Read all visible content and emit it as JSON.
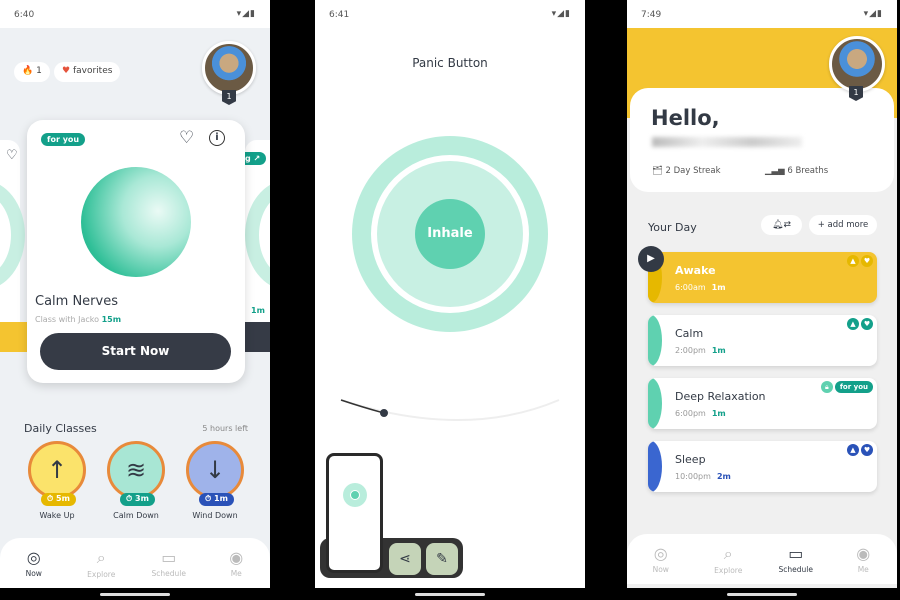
{
  "screen1": {
    "time": "6:40",
    "streak": "1",
    "favorites": "favorites",
    "level": "1",
    "card": {
      "tag": "for you",
      "title": "Calm Nerves",
      "subtitle": "Class with Jacko",
      "duration": "15m",
      "button": "Start Now"
    },
    "side_duration": "1m",
    "daily": {
      "title": "Daily Classes",
      "remaining": "5 hours left",
      "classes": [
        {
          "label": "Wake Up",
          "duration": "5m",
          "icon": "arrow-up-icon",
          "color": "#fbe36b",
          "badge": "#e6b800"
        },
        {
          "label": "Calm Down",
          "duration": "3m",
          "icon": "waves-icon",
          "color": "#a8e6d4",
          "badge": "#13a08a"
        },
        {
          "label": "Wind Down",
          "duration": "1m",
          "icon": "arrow-down-icon",
          "color": "#9fb3ea",
          "badge": "#2a52b8"
        }
      ]
    },
    "nav": [
      "Now",
      "Explore",
      "Schedule",
      "Me"
    ]
  },
  "screen2": {
    "time": "6:41",
    "title": "Panic Button",
    "center": "Inhale",
    "accent": "#5fd1b0"
  },
  "screen3": {
    "time": "7:49",
    "greeting": "Hello,",
    "streak": "2 Day Streak",
    "breaths": "6 Breaths",
    "level": "1",
    "your_day": "Your Day",
    "add_more": "+ add more",
    "items": [
      {
        "title": "Awake",
        "time": "6:00am",
        "duration": "1m",
        "color": "#f4c430"
      },
      {
        "title": "Calm",
        "time": "2:00pm",
        "duration": "1m",
        "color": "#5fd1b0"
      },
      {
        "title": "Deep Relaxation",
        "time": "6:00pm",
        "duration": "1m",
        "color": "#5fd1b0",
        "tag": "for you"
      },
      {
        "title": "Sleep",
        "time": "10:00pm",
        "duration": "2m",
        "color": "#3a66d0"
      }
    ],
    "nav": [
      "Now",
      "Explore",
      "Schedule",
      "Me"
    ]
  }
}
